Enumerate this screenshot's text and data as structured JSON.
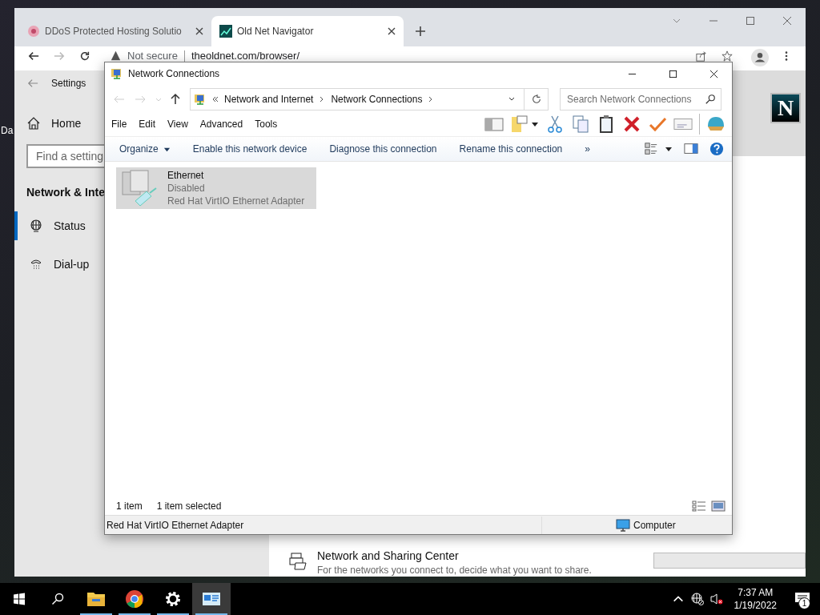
{
  "desktop": {
    "icon_label": "Da"
  },
  "browser": {
    "tabs": [
      {
        "title": "DDoS Protected Hosting Solutio",
        "selected": false
      },
      {
        "title": "Old Net Navigator",
        "selected": true
      }
    ],
    "security": "Not secure",
    "url": "theoldnet.com/browser/",
    "logo_letter": "N"
  },
  "settings": {
    "title": "Settings",
    "home": "Home",
    "search_placeholder": "Find a setting",
    "section": "Network & Inte",
    "nav": [
      {
        "label": "Status",
        "kind": "status",
        "selected": true
      },
      {
        "label": "Dial-up",
        "kind": "dialup",
        "selected": false
      }
    ],
    "link": {
      "title": "Network and Sharing Center",
      "description": "For the networks you connect to, decide what you want to share."
    }
  },
  "explorer": {
    "title": "Network Connections",
    "breadcrumb": [
      "Network and Internet",
      "Network Connections"
    ],
    "search_placeholder": "Search Network Connections",
    "menu": [
      "File",
      "Edit",
      "View",
      "Advanced",
      "Tools"
    ],
    "commands": [
      {
        "label": "Organize",
        "kind": "dropdown"
      },
      {
        "label": "Enable this network device",
        "kind": "button"
      },
      {
        "label": "Diagnose this connection",
        "kind": "button"
      },
      {
        "label": "Rename this connection",
        "kind": "button"
      }
    ],
    "more": "»",
    "items": [
      {
        "name": "Ethernet",
        "status": "Disabled",
        "device": "Red Hat VirtIO Ethernet Adapter",
        "selected": true
      }
    ],
    "status": {
      "count": "1 item",
      "selection": "1 item selected"
    },
    "details": {
      "description": "Red Hat VirtIO Ethernet Adapter",
      "zone": "Computer"
    }
  },
  "taskbar": {
    "apps": [
      {
        "kind": "explorer",
        "running": true,
        "selected": false
      },
      {
        "kind": "chrome",
        "running": true,
        "selected": false
      },
      {
        "kind": "settings",
        "running": true,
        "selected": false
      },
      {
        "kind": "network",
        "running": true,
        "selected": true
      }
    ],
    "time": "7:37 AM",
    "date": "1/19/2022",
    "notifications": "1"
  }
}
